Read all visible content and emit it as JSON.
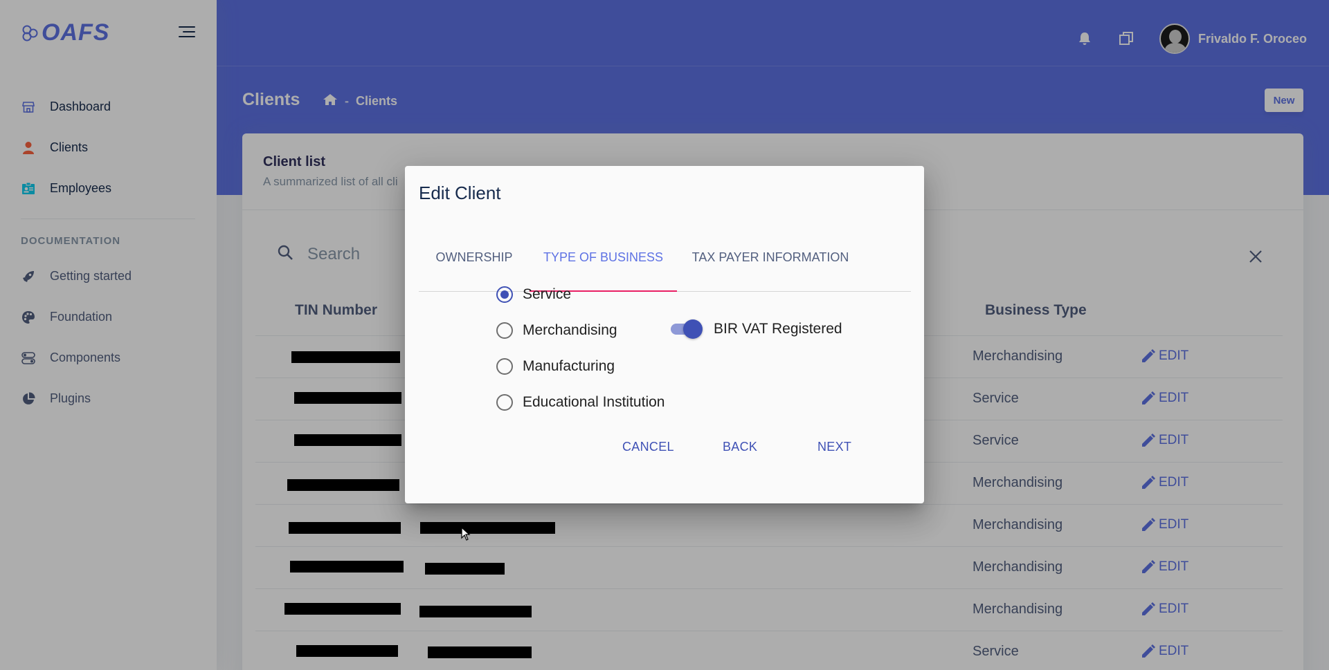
{
  "app": {
    "brand": "OAFS"
  },
  "sidebar": {
    "items": [
      {
        "label": "Dashboard",
        "icon": "shop-icon",
        "color": "#5e72e4"
      },
      {
        "label": "Clients",
        "icon": "user-icon",
        "color": "#fb6340"
      },
      {
        "label": "Employees",
        "icon": "id-card-icon",
        "color": "#11cdef"
      }
    ],
    "doc_heading": "DOCUMENTATION",
    "doc_items": [
      {
        "label": "Getting started",
        "icon": "rocket-icon"
      },
      {
        "label": "Foundation",
        "icon": "palette-icon"
      },
      {
        "label": "Components",
        "icon": "ui-components-icon"
      },
      {
        "label": "Plugins",
        "icon": "pie-chart-icon"
      }
    ]
  },
  "topbar": {
    "user_name": "Frivaldo F. Oroceo"
  },
  "header": {
    "title": "Clients",
    "breadcrumb": [
      "Clients"
    ],
    "breadcrumb_sep": "-",
    "new_button": "New"
  },
  "card": {
    "title": "Client list",
    "subtitle": "A summarized list of all cli",
    "search_placeholder": "Search",
    "columns": {
      "tin": "TIN Number",
      "business_type": "Business Type"
    },
    "edit_label": "EDIT",
    "rows": [
      {
        "business_type": "Merchandising"
      },
      {
        "business_type": "Service"
      },
      {
        "business_type": "Service"
      },
      {
        "business_type": "Merchandising"
      },
      {
        "business_type": "Merchandising"
      },
      {
        "business_type": "Merchandising"
      },
      {
        "business_type": "Merchandising"
      },
      {
        "business_type": "Service"
      }
    ]
  },
  "dialog": {
    "title": "Edit Client",
    "tabs": [
      "OWNERSHIP",
      "TYPE OF BUSINESS",
      "TAX PAYER INFORMATION"
    ],
    "active_tab": "TYPE OF BUSINESS",
    "options": [
      "Service",
      "Merchandising",
      "Manufacturing",
      "Educational Institution"
    ],
    "selected_option": "Service",
    "toggle": {
      "label": "BIR VAT Registered",
      "checked": true
    },
    "buttons": {
      "cancel": "CANCEL",
      "back": "BACK",
      "next": "NEXT"
    }
  },
  "colors": {
    "primary": "#5e72e4",
    "tab_indicator": "#e91e63",
    "radio_accent": "#3f51b5"
  }
}
